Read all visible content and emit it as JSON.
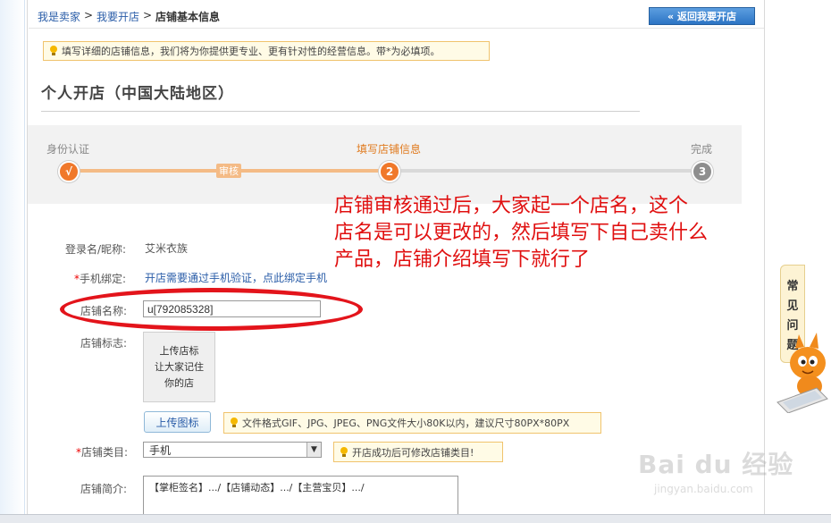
{
  "breadcrumb": {
    "seller": "我是卖家",
    "sep1": ">",
    "open_shop": "我要开店",
    "sep2": ">",
    "current": "店铺基本信息"
  },
  "back_button": "返回我要开店",
  "info_tip": "填写详细的店铺信息，我们将为你提供更专业、更有针对性的经营信息。带*为必填项。",
  "page_title": "个人开店（中国大陆地区）",
  "steps": {
    "step1_label": "身份认证",
    "step1_mark": "√",
    "review_badge": "审核",
    "step2_label": "填写店铺信息",
    "step2_num": "2",
    "step3_label": "完成",
    "step3_num": "3",
    "active_color": "#f0782a",
    "done_track_color": "#f4bb86",
    "todo_color": "#9a9a9a"
  },
  "annotation": {
    "line1": "店铺审核通过后，大家起一个店名，这个",
    "line2": "店名是可以更改的，然后填写下自己卖什么",
    "line3": "产品，店铺介绍填写下就行了"
  },
  "form": {
    "login_label": "登录名/昵称:",
    "login_value": "艾米衣族",
    "phone_label_req": "*",
    "phone_label": "手机绑定:",
    "phone_text": "开店需要通过手机验证，点此绑定手机",
    "name_label": "店铺名称:",
    "name_value": "u[792085328]",
    "logo_label": "店铺标志:",
    "logo_line1": "上传店标",
    "logo_line2": "让大家记住",
    "logo_line3": "你的店",
    "upload_button": "上传图标",
    "upload_tip": "文件格式GIF、JPG、JPEG、PNG文件大小80K以内，建议尺寸80PX*80PX",
    "category_req": "*",
    "category_label": "店铺类目:",
    "category_value": "手机",
    "category_tip": "开店成功后可修改店铺类目!",
    "intro_label": "店铺简介:",
    "intro_value": "【掌柜签名】.../【店铺动态】.../【主营宝贝】.../"
  },
  "faq_tab": [
    "常",
    "见",
    "问",
    "题"
  ],
  "watermark": {
    "main": "Bai du 经验",
    "sub": "jingyan.baidu.com"
  }
}
